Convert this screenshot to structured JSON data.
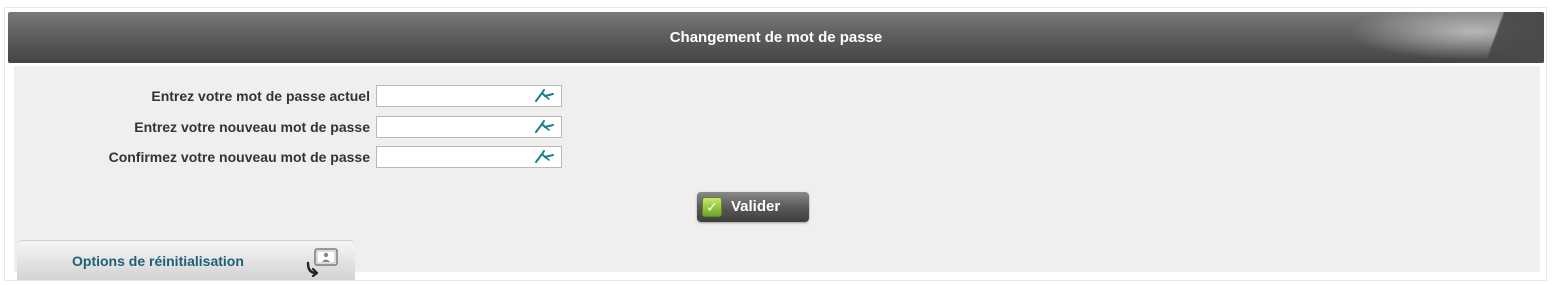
{
  "header": {
    "title": "Changement de mot de passe"
  },
  "form": {
    "fields": [
      {
        "label": "Entrez votre mot de passe actuel",
        "value": "",
        "icon": "virtual-keyboard-icon"
      },
      {
        "label": "Entrez votre nouveau mot de passe",
        "value": "",
        "icon": "virtual-keyboard-icon"
      },
      {
        "label": "Confirmez votre nouveau mot de passe",
        "value": "",
        "icon": "virtual-keyboard-icon"
      }
    ],
    "submit_label": "Valider",
    "submit_icon": "checkmark-icon"
  },
  "reset_options": {
    "label": "Options de réinitialisation",
    "icon": "reset-options-icon"
  },
  "colors": {
    "header_bg": "#5e5e5e",
    "body_bg": "#efefef",
    "label_text": "#333333",
    "tab_text": "#1e5f78",
    "check_green": "#8cc43a",
    "keyboard_icon": "#1a7f8a"
  }
}
